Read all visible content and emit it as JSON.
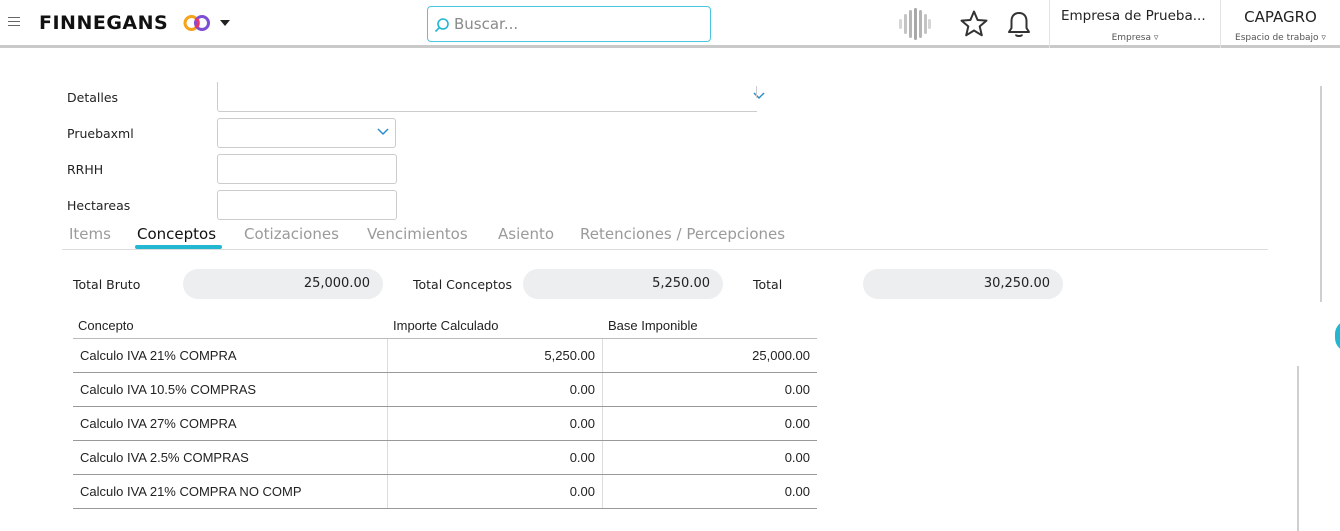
{
  "header": {
    "brand": "FINNEGANS",
    "search_placeholder": "Buscar...",
    "company_name": "Empresa de Prueba...",
    "company_label": "Empresa ▿",
    "workspace_name": "CAPAGRO",
    "workspace_label": "Espacio de trabajo ▿",
    "accent_color": "#23b7d2"
  },
  "form": {
    "fields": [
      {
        "label": "Detalles",
        "value": ""
      },
      {
        "label": "Pruebaxml",
        "value": ""
      },
      {
        "label": "RRHH",
        "value": ""
      },
      {
        "label": "Hectareas",
        "value": ""
      }
    ]
  },
  "tabs": [
    "Items",
    "Conceptos",
    "Cotizaciones",
    "Vencimientos",
    "Asiento",
    "Retenciones / Percepciones"
  ],
  "active_tab": "Conceptos",
  "totals": {
    "bruto_label": "Total Bruto",
    "bruto_value": "25,000.00",
    "conceptos_label": "Total Conceptos",
    "conceptos_value": "5,250.00",
    "total_label": "Total",
    "total_value": "30,250.00"
  },
  "table": {
    "columns": [
      "Concepto",
      "Importe Calculado",
      "Base Imponible"
    ],
    "rows": [
      [
        "Calculo IVA 21% COMPRA",
        "5,250.00",
        "25,000.00"
      ],
      [
        "Calculo IVA 10.5% COMPRAS",
        "0.00",
        "0.00"
      ],
      [
        "Calculo IVA 27% COMPRA",
        "0.00",
        "0.00"
      ],
      [
        "Calculo IVA 2.5% COMPRAS",
        "0.00",
        "0.00"
      ],
      [
        "Calculo IVA 21% COMPRA NO COMP",
        "0.00",
        "0.00"
      ]
    ]
  }
}
